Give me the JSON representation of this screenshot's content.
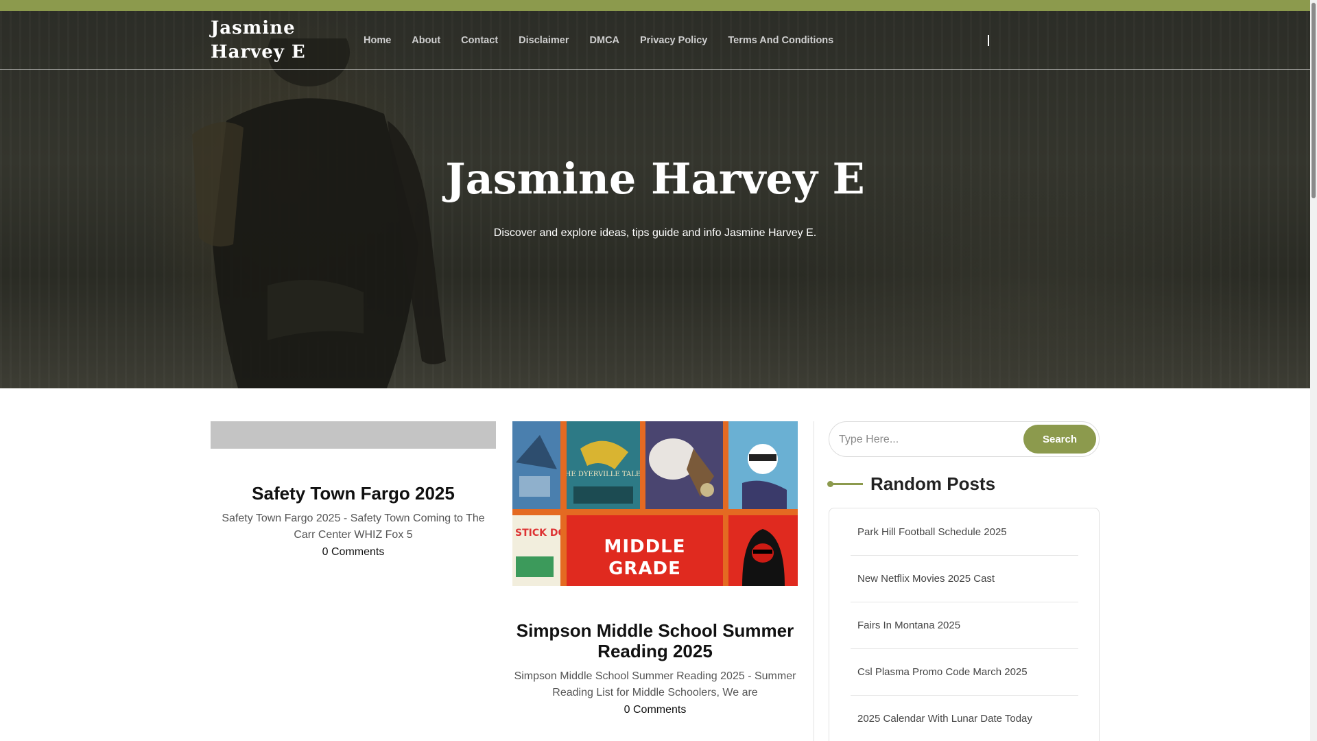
{
  "site": {
    "logo": "Jasmine Harvey E",
    "accent_color": "#8c9a4d"
  },
  "nav": {
    "items": [
      "Home",
      "About",
      "Contact",
      "Disclaimer",
      "DMCA",
      "Privacy Policy",
      "Terms And Conditions"
    ]
  },
  "hero": {
    "title": "Jasmine Harvey E",
    "subtitle": "Discover and explore ideas, tips guide and info Jasmine Harvey E."
  },
  "posts": [
    {
      "title": "Safety Town Fargo 2025",
      "excerpt": "Safety Town Fargo 2025 - Safety Town Coming to The Carr Center WHIZ Fox 5",
      "comments": "0 Comments"
    },
    {
      "title": "Simpson Middle School Summer Reading 2025",
      "excerpt": "Simpson Middle School Summer Reading 2025 - Summer Reading List for Middle Schoolers, We are",
      "comments": "0 Comments",
      "image_text": {
        "title": "THE DYERVILLE TALES",
        "line1": "MIDDLE",
        "line2": "GRADE",
        "side": "STICK DOG"
      }
    }
  ],
  "sidebar": {
    "search": {
      "placeholder": "Type Here...",
      "button": "Search"
    },
    "random_title": "Random Posts",
    "random_posts": [
      "Park Hill Football Schedule 2025",
      "New Netflix Movies 2025 Cast",
      "Fairs In Montana 2025",
      "Csl Plasma Promo Code March 2025",
      "2025 Calendar With Lunar Date Today"
    ]
  }
}
